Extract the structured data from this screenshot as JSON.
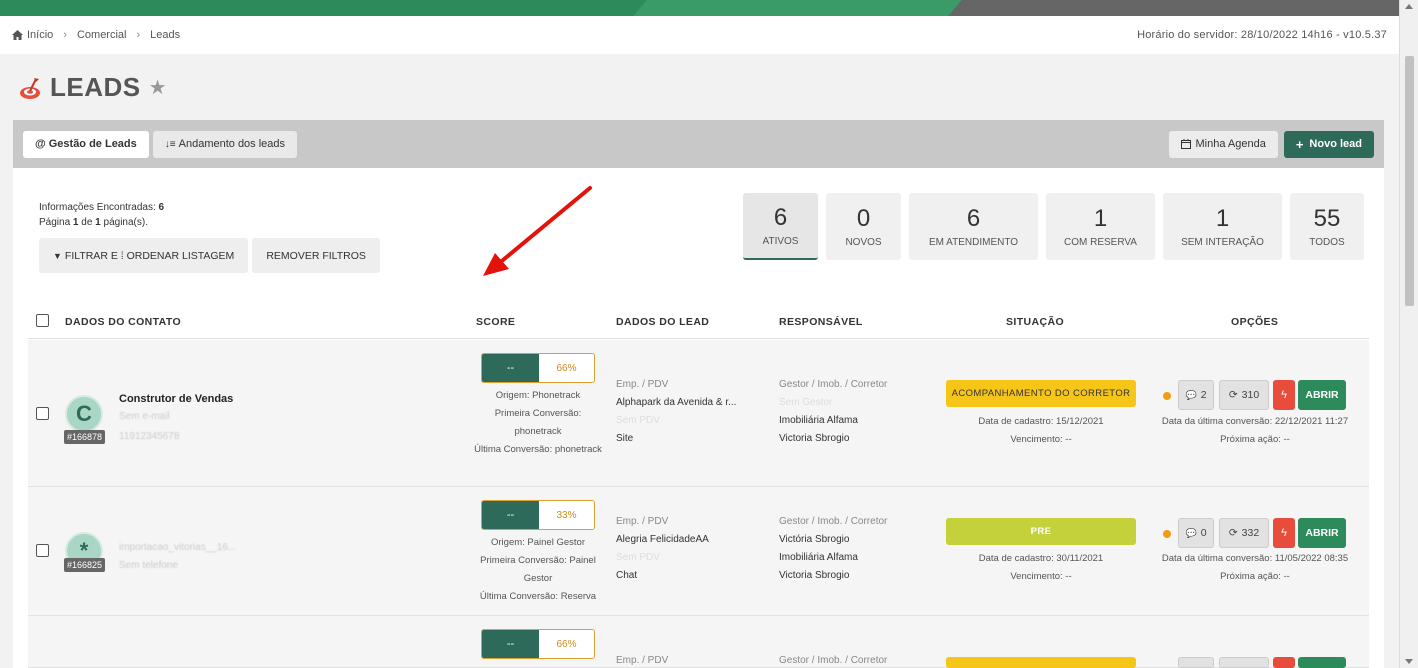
{
  "breadcrumb": {
    "home": "Início",
    "comercial": "Comercial",
    "leads": "Leads"
  },
  "server_time": "Horário do servidor: 28/10/2022 14h16 - v10.5.37",
  "page": {
    "title": "LEADS"
  },
  "tabs": {
    "gestao": "Gestão de Leads",
    "andamento": "Andamento dos leads"
  },
  "actions": {
    "agenda": "Minha Agenda",
    "novo": "Novo lead"
  },
  "info": {
    "found_label": "Informações Encontradas:",
    "found_count": "6",
    "page_prefix": "Página",
    "page_num": "1",
    "page_of": "de",
    "page_total": "1",
    "page_suffix": "página(s)."
  },
  "filters": {
    "filter_label": "FILTRAR E ⁞ ORDENAR LISTAGEM",
    "remove_label": "REMOVER FILTROS"
  },
  "stats": [
    {
      "num": "6",
      "label": "Ativos"
    },
    {
      "num": "0",
      "label": "Novos"
    },
    {
      "num": "6",
      "label": "Em atendimento"
    },
    {
      "num": "1",
      "label": "Com reserva"
    },
    {
      "num": "1",
      "label": "Sem interação"
    },
    {
      "num": "55",
      "label": "Todos"
    }
  ],
  "columns": {
    "contato": "DADOS DO CONTATO",
    "score": "SCORE",
    "lead": "DADOS DO LEAD",
    "responsavel": "RESPONSÁVEL",
    "situacao": "SITUAÇÃO",
    "opcoes": "OPÇÕES"
  },
  "colors": {
    "brand": "#2d6a5a",
    "accent_yellow": "#f5c518",
    "accent_green": "#c4d13a",
    "danger": "#e74c3c"
  },
  "rows": [
    {
      "avatar": "C",
      "id": "#166878",
      "name": "Construtor de Vendas",
      "email": "Sem e-mail",
      "phone": "11912345678",
      "score_left": "--",
      "score_right": "66%",
      "origem": "Origem: Phonetrack",
      "primeira": "Primeira Conversão: phonetrack",
      "ultima": "Última Conversão: phonetrack",
      "emp_label": "Emp. / PDV",
      "emp": "Alphapark da Avenida & r...",
      "pdv": "Sem PDV",
      "canal": "Site",
      "resp_label": "Gestor / Imob. / Corretor",
      "gestor": "Sem Gestor",
      "imob": "Imobiliária Alfama",
      "corretor": "Victoria Sbrogio",
      "status": "ACOMPANHAMENTO DO CORRETOR",
      "cadastro": "Data de cadastro: 15/12/2021",
      "vencimento": "Vencimento: --",
      "comments": "2",
      "interactions": "310",
      "open": "ABRIR",
      "ultima_conv": "Data da última conversão: 22/12/2021 11:27",
      "proxima": "Próxima ação: --"
    },
    {
      "avatar": "*",
      "id": "#166825",
      "name": "importacao_vitorias__16...",
      "phone": "Sem telefone",
      "score_left": "--",
      "score_right": "33%",
      "origem": "Origem: Painel Gestor",
      "primeira": "Primeira Conversão: Painel Gestor",
      "ultima": "Última Conversão: Reserva",
      "emp_label": "Emp. / PDV",
      "emp": "Alegria FelicidadeAA",
      "pdv": "Sem PDV",
      "canal": "Chat",
      "resp_label": "Gestor / Imob. / Corretor",
      "gestor": "Victória Sbrogio",
      "imob": "Imobiliária Alfama",
      "corretor": "Victoria Sbrogio",
      "status": "PRE",
      "cadastro": "Data de cadastro: 30/11/2021",
      "vencimento": "Vencimento: --",
      "comments": "0",
      "interactions": "332",
      "open": "ABRIR",
      "ultima_conv": "Data da última conversão: 11/05/2022 08:35",
      "proxima": "Próxima ação: --"
    },
    {
      "score_left": "--",
      "score_right": "66%",
      "emp_label": "Emp. / PDV",
      "resp_label": "Gestor / Imob. / Corretor"
    }
  ]
}
